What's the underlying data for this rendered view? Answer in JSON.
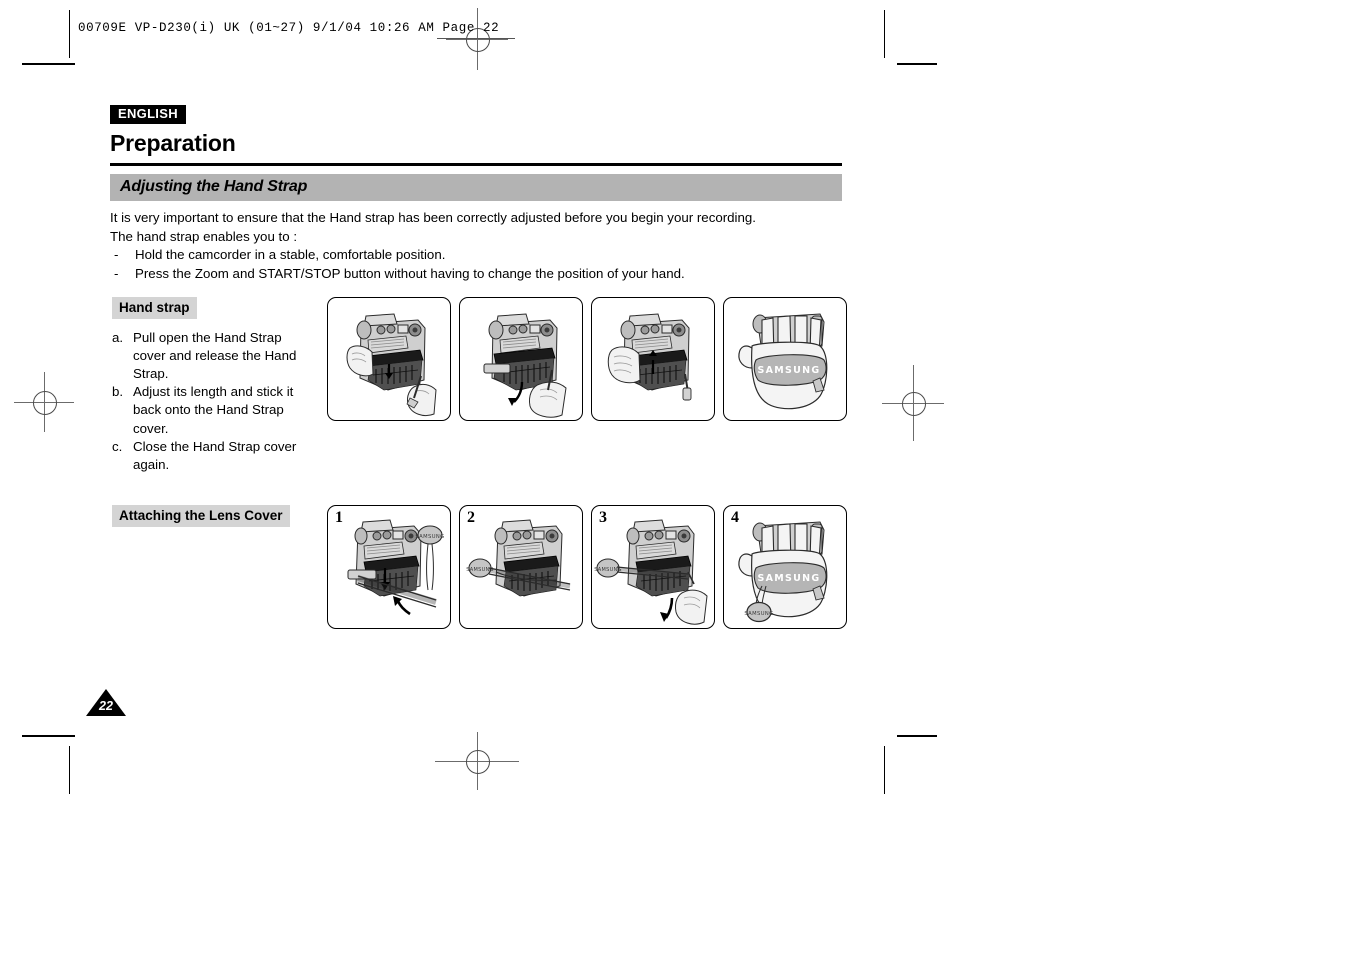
{
  "document": {
    "header_slug": "00709E VP-D230(i) UK (01~27)   9/1/04 10:26 AM   Page 22",
    "language_badge": "ENGLISH",
    "chapter_title": "Preparation",
    "page_number": "22"
  },
  "section": {
    "band_title": "Adjusting the Hand Strap",
    "intro_line1": "It is very important to ensure that the Hand strap has been correctly adjusted before you begin your recording.",
    "intro_line2": "The hand strap enables you to :",
    "bullets": [
      {
        "marker": "-",
        "text": "Hold the camcorder in a stable, comfortable position."
      },
      {
        "marker": "-",
        "text": "Press the Zoom and START/STOP button without having to change the position of your hand."
      }
    ]
  },
  "hand_strap": {
    "label": "Hand strap",
    "steps": [
      {
        "key": "a.",
        "text": "Pull open the Hand Strap cover and release the Hand Strap."
      },
      {
        "key": "b.",
        "text": "Adjust its length and stick it back onto the Hand Strap cover."
      },
      {
        "key": "c.",
        "text": "Close the Hand Strap cover again."
      }
    ],
    "panels": [
      {
        "num": "",
        "caption": "Hand opening the hand strap cover on camcorder"
      },
      {
        "num": "",
        "caption": "Hand pulling hand strap to adjust length"
      },
      {
        "num": "",
        "caption": "Hand closing the hand strap cover"
      },
      {
        "num": "",
        "caption": "Hand inserted through fastened SAMSUNG hand strap"
      }
    ]
  },
  "lens_cover": {
    "label": "Attaching the Lens Cover",
    "panels": [
      {
        "num": "1",
        "caption": "Lens cover with cord held beside camcorder hand strap"
      },
      {
        "num": "2",
        "caption": "Lens cover cord threaded under the hand strap"
      },
      {
        "num": "3",
        "caption": "Hand pulling lens cover cord through the strap"
      },
      {
        "num": "4",
        "caption": "Lens cover hanging from fastened SAMSUNG hand strap"
      }
    ]
  },
  "strap_brand": "SAMSUNG",
  "colors": {
    "band_gray": "#b3b3b3",
    "label_gray": "#d4d4d4",
    "ink_black": "#000000",
    "reg_gray": "#6b6b6b"
  }
}
